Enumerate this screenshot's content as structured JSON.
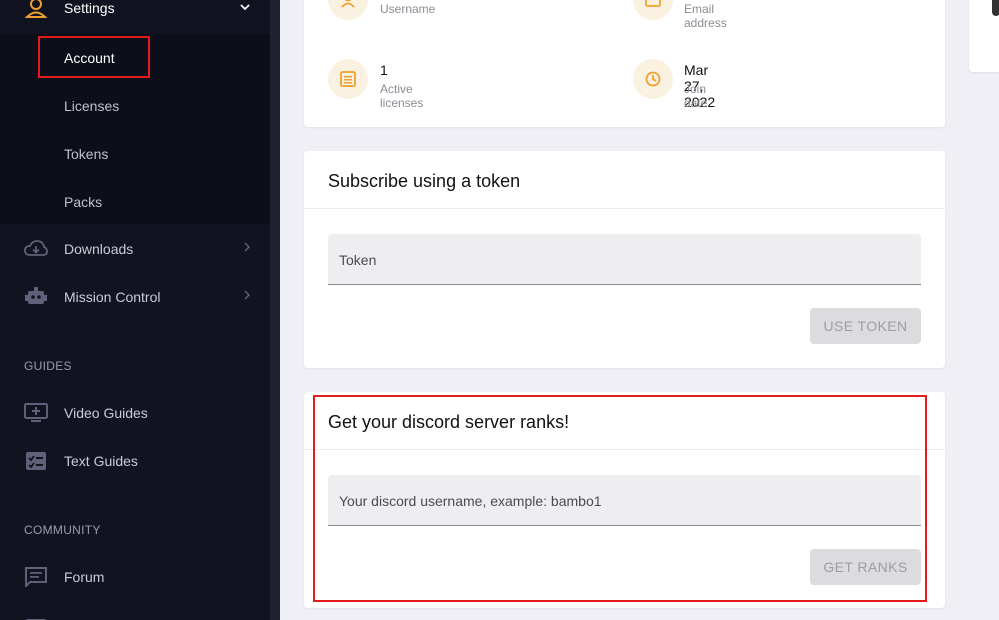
{
  "sidebar": {
    "settings_label": "Settings",
    "settings_sub": [
      "Account",
      "Licenses",
      "Tokens",
      "Packs"
    ],
    "downloads_label": "Downloads",
    "mission_control_label": "Mission Control",
    "guides_title": "GUIDES",
    "video_guides_label": "Video Guides",
    "text_guides_label": "Text Guides",
    "community_title": "COMMUNITY",
    "forum_label": "Forum"
  },
  "profile": {
    "username_label": "Username",
    "email_label": "Email address",
    "licenses_value": "1",
    "licenses_label": "Active licenses",
    "join_value": "Mar 27, 2022",
    "join_label": "Join date"
  },
  "token_card": {
    "title": "Subscribe using a token",
    "placeholder": "Token",
    "button": "USE TOKEN"
  },
  "discord_card": {
    "title": "Get your discord server ranks!",
    "placeholder": "Your discord username, example: bambo1",
    "button": "GET RANKS"
  },
  "colors": {
    "accent": "#f0a030",
    "sidebar_bg": "#111320",
    "highlight": "#e21b1b"
  }
}
